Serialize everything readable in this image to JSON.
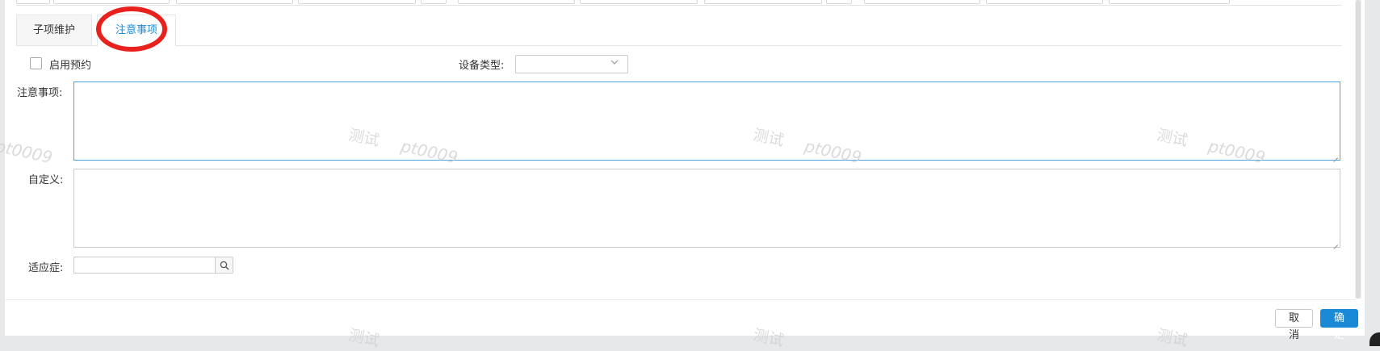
{
  "tabs": [
    {
      "label": "子项维护",
      "active": false
    },
    {
      "label": "注意事项",
      "active": true
    }
  ],
  "form": {
    "enable_booking_label": "启用预约",
    "enable_booking_checked": false,
    "device_type_label": "设备类型:",
    "device_type_value": "",
    "notes_label": "注意事项:",
    "notes_value": "",
    "custom_label": "自定义:",
    "custom_value": "",
    "indication_label": "适应症:",
    "indication_value": ""
  },
  "footer": {
    "cancel_label": "取 消",
    "ok_label": "确 定"
  },
  "watermark": {
    "text_cn": "测试",
    "text_user": "pt0009"
  },
  "colors": {
    "accent": "#1a8ad6",
    "highlight_circle": "#e8211d"
  }
}
